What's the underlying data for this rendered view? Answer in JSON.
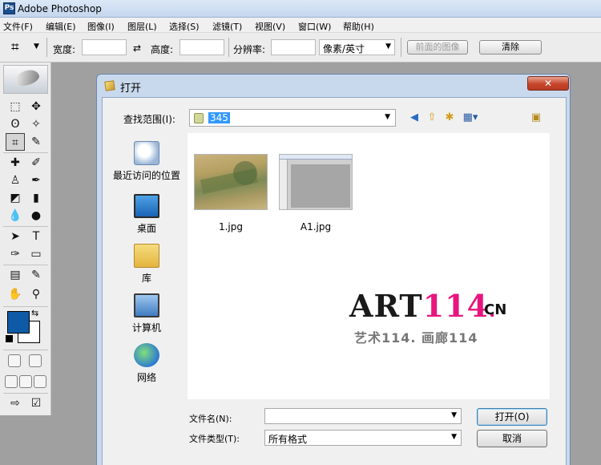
{
  "app": {
    "title": "Adobe Photoshop",
    "icon_label": "Ps"
  },
  "menu": {
    "items": [
      "文件(F)",
      "编辑(E)",
      "图像(I)",
      "图层(L)",
      "选择(S)",
      "滤镜(T)",
      "视图(V)",
      "窗口(W)",
      "帮助(H)"
    ]
  },
  "options_bar": {
    "tool_icon": "crop-icon",
    "width_label": "宽度:",
    "width_value": "",
    "swap_icon": "⇄",
    "height_label": "高度:",
    "height_value": "",
    "resolution_label": "分辨率:",
    "resolution_value": "",
    "unit": "像素/英寸",
    "front_image_label": "前面的图像",
    "clear_label": "清除"
  },
  "toolbox": {
    "foreground_color": "#0e5aa7",
    "background_color": "#ffffff"
  },
  "dialog": {
    "title": "打开",
    "close_label": "✕",
    "look_in_label": "查找范围(I):",
    "look_in_value": "345",
    "places": [
      {
        "label": "最近访问的位置",
        "icon": "recent-places-icon"
      },
      {
        "label": "桌面",
        "icon": "desktop-icon"
      },
      {
        "label": "库",
        "icon": "libraries-icon"
      },
      {
        "label": "计算机",
        "icon": "computer-icon"
      },
      {
        "label": "网络",
        "icon": "network-icon"
      }
    ],
    "files": [
      {
        "name": "1.jpg"
      },
      {
        "name": "A1.jpg"
      }
    ],
    "watermark": {
      "art": "ART",
      "num": "114",
      "dot": ".",
      "cn": "CN",
      "sub": "艺术114. 画廊114"
    },
    "filename_label": "文件名(N):",
    "filename_value": "",
    "filetype_label": "文件类型(T):",
    "filetype_value": "所有格式",
    "open_label": "打开(O)",
    "cancel_label": "取消"
  }
}
